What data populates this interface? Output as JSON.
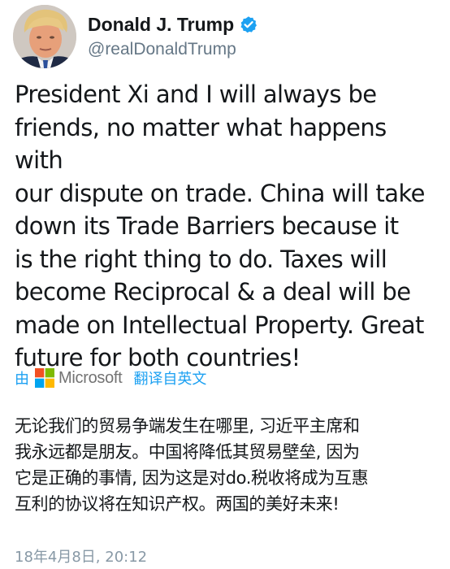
{
  "tweet": {
    "display_name": "Donald J. Trump",
    "handle": "@realDonaldTrump",
    "verified": true,
    "text_lines": [
      "President Xi and I will always be",
      "friends, no matter what happens with",
      "our dispute on trade. China will take",
      "down its Trade Barriers because it",
      "is the right thing to do. Taxes will",
      "become Reciprocal & a deal will be",
      "made on Intellectual Property. Great",
      "future for both countries!"
    ],
    "timestamp": "18年4月8日, 20:12"
  },
  "translation": {
    "by_label": "由",
    "provider_name": "Microsoft",
    "action_label": "翻译自英文",
    "text_lines": [
      "无论我们的贸易争端发生在哪里, 习近平主席和",
      "我永远都是朋友。中国将降低其贸易壁垒, 因为",
      "它是正确的事情, 因为这是对do.税收将成为互惠",
      "互利的协议将在知识产权。两国的美好未来!"
    ]
  },
  "icons": {
    "verified": "verified-badge-icon",
    "provider_logo": "microsoft-logo-icon"
  },
  "colors": {
    "link_blue": "#1da1f2",
    "verified_blue": "#1da1f2",
    "secondary_gray": "#657786",
    "timestamp_gray": "#8899a6",
    "ms_red": "#f25022",
    "ms_green": "#7fba00",
    "ms_blue": "#00a4ef",
    "ms_yellow": "#ffb900"
  }
}
